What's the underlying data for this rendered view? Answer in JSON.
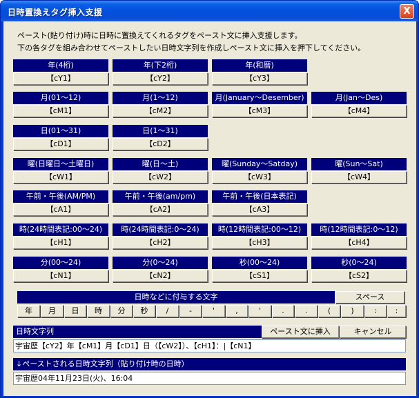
{
  "window": {
    "title": "日時置換えタグ挿入支援",
    "close_label": "X"
  },
  "intro": [
    "ペースト(貼り付け)時に日時に置換えてくれるタグをペースト文に挿入支援します。",
    "下の各タグを組み合わせてペーストしたい日時文字列を作成しペースト文に挿入を押下してください。"
  ],
  "tags": [
    [
      {
        "label": "年(4桁)",
        "tag": "【cY1】"
      },
      {
        "label": "年(下2桁)",
        "tag": "【cY2】"
      },
      {
        "label": "年(和暦)",
        "tag": "【cY3】"
      }
    ],
    [
      {
        "label": "月(01～12)",
        "tag": "【cM1】"
      },
      {
        "label": "月(1～12)",
        "tag": "【cM2】"
      },
      {
        "label": "月(January～Desember)",
        "tag": "【cM3】"
      },
      {
        "label": "月(Jan～Des)",
        "tag": "【cM4】"
      }
    ],
    [
      {
        "label": "日(01～31)",
        "tag": "【cD1】"
      },
      {
        "label": "日(1～31)",
        "tag": "【cD2】"
      }
    ],
    [
      {
        "label": "曜(日曜日～土曜日)",
        "tag": "【cW1】"
      },
      {
        "label": "曜(日～土)",
        "tag": "【cW2】"
      },
      {
        "label": "曜(Sunday～Satday)",
        "tag": "【cW3】"
      },
      {
        "label": "曜(Sun～Sat)",
        "tag": "【cW4】"
      }
    ],
    [
      {
        "label": "午前・午後(AM/PM)",
        "tag": "【cA1】"
      },
      {
        "label": "午前・午後(am/pm)",
        "tag": "【cA2】"
      },
      {
        "label": "午前・午後(日本表記)",
        "tag": "【cA3】"
      }
    ],
    [
      {
        "label": "時(24時間表記:00～24)",
        "tag": "【cH1】"
      },
      {
        "label": "時(24時間表記:0～24)",
        "tag": "【cH2】"
      },
      {
        "label": "時(12時間表記:00～12)",
        "tag": "【cH3】"
      },
      {
        "label": "時(12時間表記:0～12)",
        "tag": "【cH4】"
      }
    ],
    [
      {
        "label": "分(00～24)",
        "tag": "【cN1】"
      },
      {
        "label": "分(0～24)",
        "tag": "【cN2】"
      },
      {
        "label": "秒(00～24)",
        "tag": "【cS1】"
      },
      {
        "label": "秒(0～24)",
        "tag": "【cS2】"
      }
    ]
  ],
  "extras": {
    "header": "日時などに付与する文字",
    "space_label": "スペース",
    "chars": [
      "年",
      "月",
      "日",
      "時",
      "分",
      "秒",
      "/",
      "-",
      "'",
      ",",
      "'",
      ".",
      ".",
      "(",
      ")",
      ":",
      ":"
    ]
  },
  "datetime": {
    "header": "日時文字列",
    "insert_label": "ペースト文に挿入",
    "cancel_label": "キャンセル",
    "value": "宇宙歴【cY2】年【cM1】月【cD1】日（【cW2】）、【cH1】：|【cN1】"
  },
  "preview": {
    "header": "↓ペーストされる日時文字列（貼り付け時の日時）",
    "value": "宇宙歴04年11月23日(火)、16:04"
  }
}
